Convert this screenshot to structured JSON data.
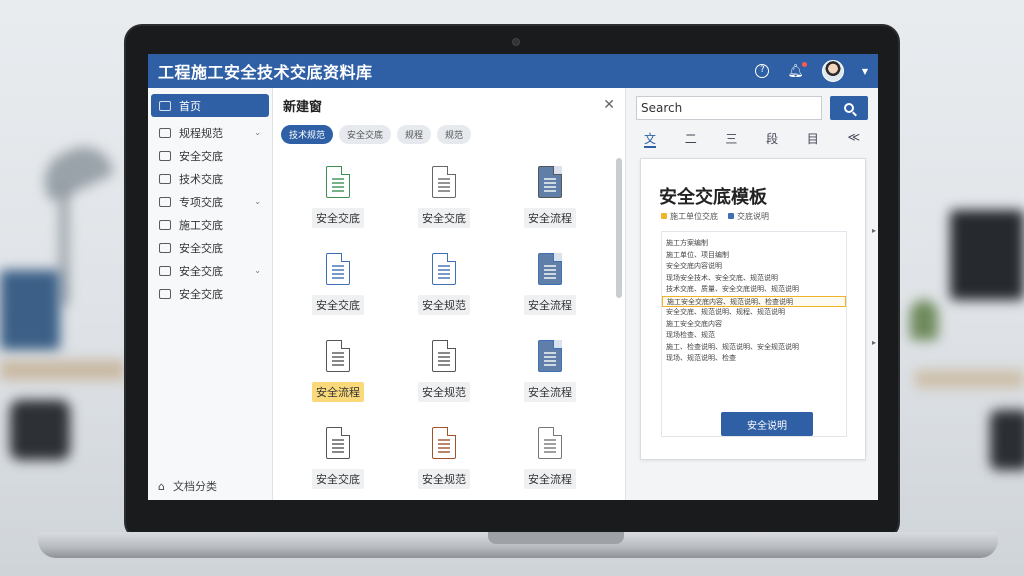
{
  "app": {
    "title": "工程施工安全技术交底资料库"
  },
  "sidebar": {
    "items": [
      {
        "label": "首页",
        "active": true
      },
      {
        "label": "规程规范",
        "chevron": true
      },
      {
        "label": "安全交底"
      },
      {
        "label": "技术交底"
      },
      {
        "label": "专项交底",
        "chevron": true
      },
      {
        "label": "施工交底"
      },
      {
        "label": "安全交底"
      },
      {
        "label": "安全交底",
        "chevron": true
      },
      {
        "label": "安全交底"
      }
    ],
    "footer": "文档分类"
  },
  "middle": {
    "heading": "新建窗",
    "chips": [
      {
        "label": "技术规范",
        "active": true
      },
      {
        "label": "安全交底"
      },
      {
        "label": "规程"
      },
      {
        "label": "规范"
      }
    ],
    "docs": [
      {
        "label": "安全交底",
        "color": "#3e8f54"
      },
      {
        "label": "安全交底",
        "color": "#666666"
      },
      {
        "label": "安全流程",
        "color": "#555555",
        "fill": true
      },
      {
        "label": "安全交底",
        "color": "#3f6fb5"
      },
      {
        "label": "安全规范",
        "color": "#3f6fb5"
      },
      {
        "label": "安全流程",
        "color": "#3f6fb5",
        "fill": true
      },
      {
        "label": "安全流程",
        "color": "#555555",
        "highlight": true
      },
      {
        "label": "安全规范",
        "color": "#555555"
      },
      {
        "label": "安全流程",
        "color": "#3f6fb5",
        "fill": true
      },
      {
        "label": "安全交底",
        "color": "#555555"
      },
      {
        "label": "安全规范",
        "color": "#a0522d"
      },
      {
        "label": "安全流程",
        "color": "#777777"
      }
    ]
  },
  "right": {
    "search": {
      "value": "Search"
    },
    "toolbar": [
      "文",
      "二",
      "三",
      "段",
      "目",
      "≪"
    ],
    "preview": {
      "title": "安全交底模板",
      "legend": [
        {
          "label": "施工单位交底",
          "color": "#f0b429"
        },
        {
          "label": "交底说明",
          "color": "#3f6fb5"
        }
      ],
      "lines": [
        "施工方案编制",
        "施工单位、项目编制",
        "安全交底内容说明",
        "现场安全技术、安全交底、规范说明",
        "技术交底、质量、安全交底说明、规范说明",
        "施工安全交底内容、规范说明、检查说明",
        "安全交底、规范说明、规程、规范说明",
        "施工安全交底内容",
        "现场检查、规范",
        "施工、检查说明、规范说明、安全规范说明",
        "现场、规范说明、检查"
      ],
      "button": "安全说明"
    }
  }
}
